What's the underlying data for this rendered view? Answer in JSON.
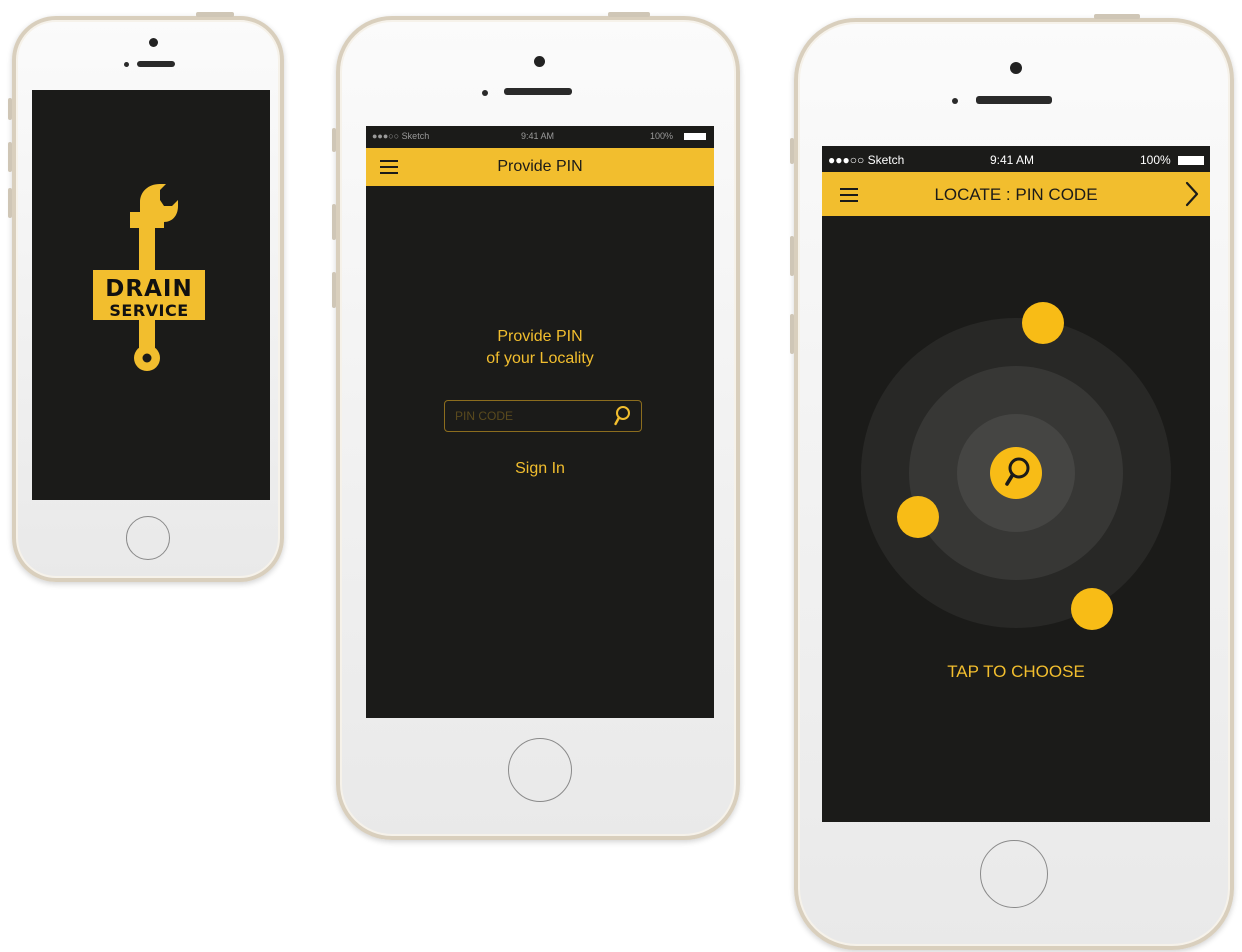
{
  "colors": {
    "accent": "#f2be2e",
    "screen_bg": "#1b1b19",
    "orb": "#f8bc16"
  },
  "phone1": {
    "logo": {
      "line1": "DRAIN",
      "line2": "SERVICE"
    }
  },
  "phone2": {
    "status": {
      "carrier": "●●●○○ Sketch",
      "time": "9:41 AM",
      "battery": "100%"
    },
    "header": {
      "title": "Provide PIN",
      "menu_icon": "hamburger-icon"
    },
    "prompt_line1": "Provide PIN",
    "prompt_line2": "of your Locality",
    "pin_input": {
      "placeholder": "PIN CODE",
      "value": "",
      "icon": "search-icon"
    },
    "sign_in_label": "Sign In"
  },
  "phone3": {
    "status": {
      "carrier": "●●●○○ Sketch",
      "time": "9:41 AM",
      "battery": "100%"
    },
    "header": {
      "title": "LOCATE : PIN CODE",
      "menu_icon": "hamburger-icon",
      "next_icon": "chevron-right-icon"
    },
    "center_icon": "search-icon",
    "tap_label": "TAP TO CHOOSE"
  }
}
